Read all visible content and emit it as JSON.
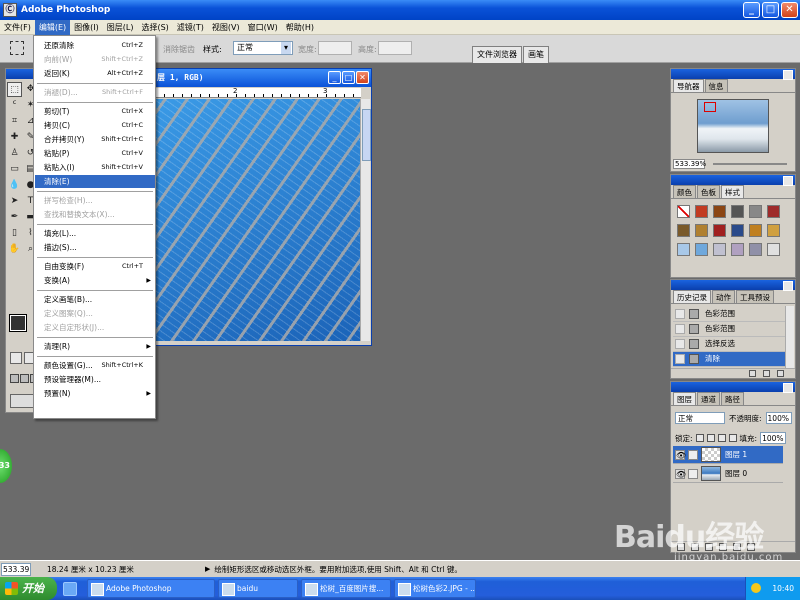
{
  "app": {
    "title": "Adobe Photoshop",
    "icon": "photoshop-app-icon"
  },
  "window_buttons": {
    "minimize": "_",
    "maximize": "□",
    "close": "✕"
  },
  "menubar": [
    "文件(F)",
    "编辑(E)",
    "图像(I)",
    "图层(L)",
    "选择(S)",
    "滤镜(T)",
    "视图(V)",
    "窗口(W)",
    "帮助(H)"
  ],
  "options": {
    "feather_label": "消除锯齿",
    "style_label": "样式:",
    "style_value": "正常",
    "width_label": "宽度:",
    "height_label": "高度:",
    "palette_well_tabs": [
      "文件浏览器",
      "画笔"
    ]
  },
  "document": {
    "title": "层 1, RGB)",
    "ruler_ticks": [
      "2",
      "3"
    ]
  },
  "edit_menu": [
    {
      "label": "还原清除",
      "shortcut": "Ctrl+Z",
      "state": "normal"
    },
    {
      "label": "向前(W)",
      "shortcut": "Shift+Ctrl+Z",
      "state": "disabled"
    },
    {
      "label": "返回(K)",
      "shortcut": "Alt+Ctrl+Z",
      "state": "normal"
    },
    {
      "sep": true
    },
    {
      "label": "消褪(D)...",
      "shortcut": "Shift+Ctrl+F",
      "state": "disabled"
    },
    {
      "sep": true
    },
    {
      "label": "剪切(T)",
      "shortcut": "Ctrl+X",
      "state": "normal"
    },
    {
      "label": "拷贝(C)",
      "shortcut": "Ctrl+C",
      "state": "normal"
    },
    {
      "label": "合并拷贝(Y)",
      "shortcut": "Shift+Ctrl+C",
      "state": "normal"
    },
    {
      "label": "粘贴(P)",
      "shortcut": "Ctrl+V",
      "state": "normal"
    },
    {
      "label": "粘贴入(I)",
      "shortcut": "Shift+Ctrl+V",
      "state": "normal"
    },
    {
      "label": "清除(E)",
      "shortcut": "",
      "state": "highlighted"
    },
    {
      "sep": true
    },
    {
      "label": "拼写检查(H)...",
      "shortcut": "",
      "state": "disabled"
    },
    {
      "label": "查找和替换文本(X)...",
      "shortcut": "",
      "state": "disabled"
    },
    {
      "sep": true
    },
    {
      "label": "填充(L)...",
      "shortcut": "",
      "state": "normal"
    },
    {
      "label": "描边(S)...",
      "shortcut": "",
      "state": "normal"
    },
    {
      "sep": true
    },
    {
      "label": "自由变换(F)",
      "shortcut": "Ctrl+T",
      "state": "normal"
    },
    {
      "label": "变换(A)",
      "shortcut": "",
      "state": "normal",
      "submenu": true
    },
    {
      "sep": true
    },
    {
      "label": "定义画笔(B)...",
      "shortcut": "",
      "state": "normal"
    },
    {
      "label": "定义图案(Q)...",
      "shortcut": "",
      "state": "disabled"
    },
    {
      "label": "定义自定形状(J)...",
      "shortcut": "",
      "state": "disabled"
    },
    {
      "sep": true
    },
    {
      "label": "清理(R)",
      "shortcut": "",
      "state": "normal",
      "submenu": true
    },
    {
      "sep": true
    },
    {
      "label": "颜色设置(G)...",
      "shortcut": "Shift+Ctrl+K",
      "state": "normal"
    },
    {
      "label": "预设管理器(M)...",
      "shortcut": "",
      "state": "normal"
    },
    {
      "label": "预置(N)",
      "shortcut": "",
      "state": "normal",
      "submenu": true
    }
  ],
  "navigator": {
    "tabs": [
      "导航器",
      "信息"
    ],
    "zoom": "533.39%"
  },
  "styles": {
    "tabs": [
      "颜色",
      "色板",
      "样式"
    ],
    "swatch_colors": [
      "#ffffff",
      "#c23b22",
      "#8b4513",
      "#555555",
      "#888888",
      "#9e2b2b",
      "#7a5a2a",
      "#b08030",
      "#a02020",
      "#2a4a8a",
      "#c08020",
      "#d0a040",
      "#a8c8e8",
      "#6fa8dc",
      "#c0c0d0",
      "#b0a0c0",
      "#9090a8",
      "#e0e0e0"
    ]
  },
  "history": {
    "tabs": [
      "历史记录",
      "动作",
      "工具预设"
    ],
    "items": [
      {
        "label": "色彩范围",
        "selected": false
      },
      {
        "label": "色彩范围",
        "selected": false
      },
      {
        "label": "选择反选",
        "selected": false
      },
      {
        "label": "清除",
        "selected": true
      }
    ]
  },
  "layers": {
    "tabs": [
      "图层",
      "通道",
      "路径"
    ],
    "blend_mode": "正常",
    "opacity_label": "不透明度:",
    "opacity": "100%",
    "lock_label": "锁定:",
    "fill_label": "填充:",
    "fill": "100%",
    "items": [
      {
        "name": "图层 1",
        "selected": true
      },
      {
        "name": "图层 0",
        "selected": false
      }
    ]
  },
  "statusbar": {
    "zoom": "533.39",
    "doc_size": "18.24 厘米 x 10.23 厘米",
    "hint": "绘制矩形选区或移动选区外框。要用附加选项,使用 Shift、Alt 和 Ctrl 键。"
  },
  "green_dot": "33",
  "watermark": {
    "text": "Baidu经验",
    "url": "jingyan.baidu.com"
  },
  "taskbar": {
    "start": "开始",
    "tasks": [
      "Adobe Photoshop",
      "baidu",
      "松树_百度图片搜...",
      "松树色彩2.JPG - ..."
    ],
    "clock": "10:40"
  }
}
